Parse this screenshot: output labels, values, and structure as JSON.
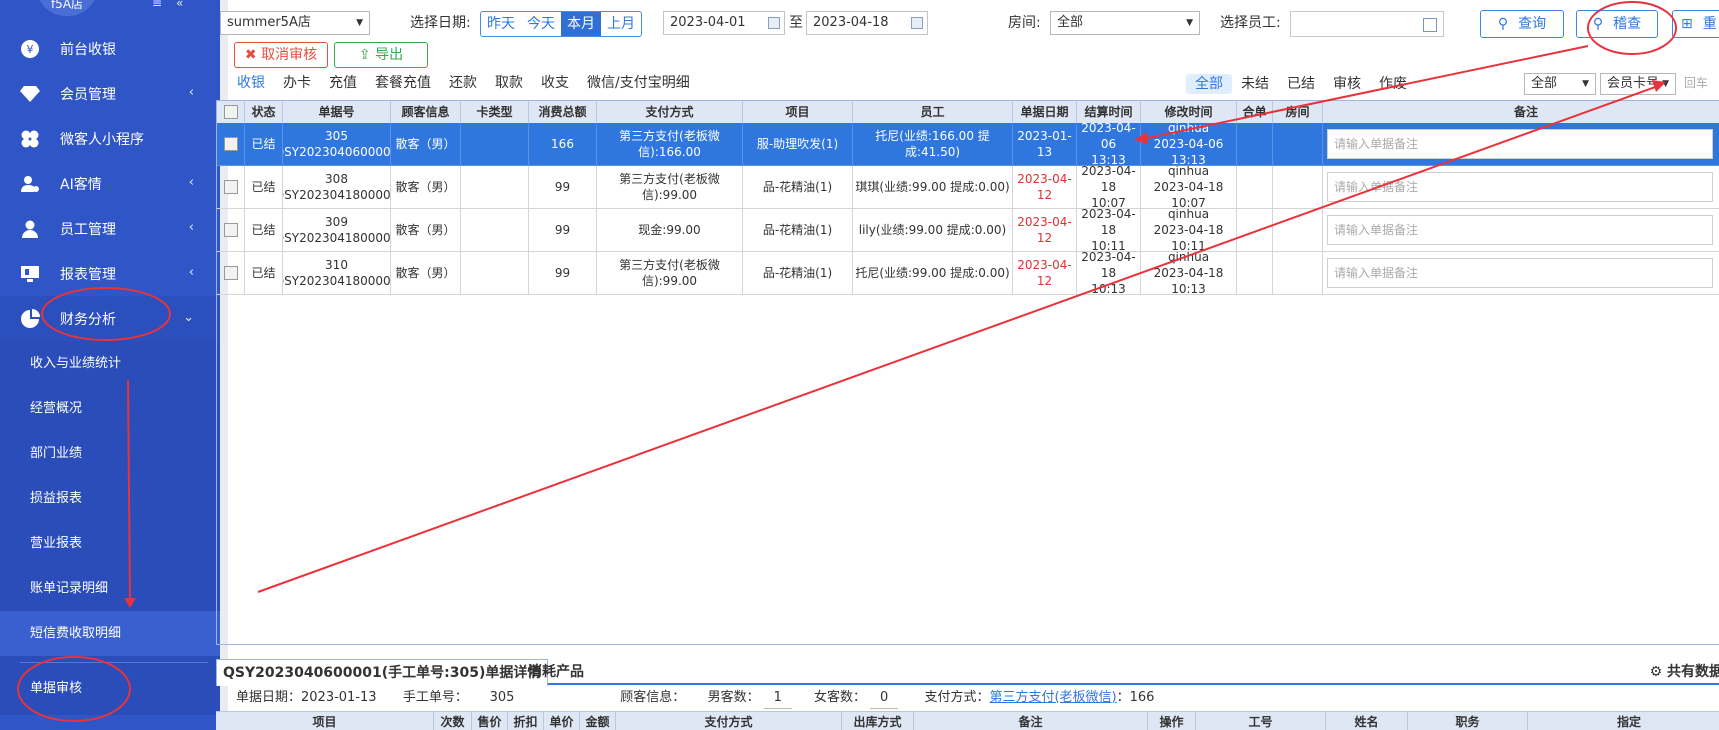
{
  "sidebar": {
    "logo": "f5A店",
    "menu": [
      {
        "label": "前台收银",
        "icon": "yen-icon",
        "arrow": ""
      },
      {
        "label": "会员管理",
        "icon": "diamond-icon",
        "arrow": "‹"
      },
      {
        "label": "微客人小程序",
        "icon": "clover-icon",
        "arrow": ""
      },
      {
        "label": "AI客情",
        "icon": "user-chat-icon",
        "arrow": "‹"
      },
      {
        "label": "员工管理",
        "icon": "person-icon",
        "arrow": "‹"
      },
      {
        "label": "报表管理",
        "icon": "monitor-icon",
        "arrow": "‹"
      },
      {
        "label": "财务分析",
        "icon": "pie-chart-icon",
        "arrow": "⌄"
      }
    ],
    "sub": [
      "收入与业绩统计",
      "经营概况",
      "部门业绩",
      "损益报表",
      "营业报表",
      "账单记录明细",
      "短信费收取明细"
    ],
    "last": "单据审核"
  },
  "toolbar": {
    "store": "summer5A店",
    "date_label": "选择日期:",
    "quick": [
      "昨天",
      "今天",
      "本月",
      "上月"
    ],
    "date_from": "2023-04-01",
    "to": "至",
    "date_to": "2023-04-18",
    "room_label": "房间:",
    "room_value": "全部",
    "emp_label": "选择员工:",
    "query": "查询",
    "audit": "稽查",
    "reset": "重"
  },
  "actions": {
    "cancel_audit": "取消审核",
    "export": "导出"
  },
  "tabs": [
    "收银",
    "办卡",
    "充值",
    "套餐充值",
    "还款",
    "取款",
    "收支",
    "微信/支付宝明细"
  ],
  "filters": [
    "全部",
    "未结",
    "已结",
    "审核",
    "作废"
  ],
  "filter_select": "全部",
  "card_select": "会员卡号",
  "enter_hint": "回车",
  "table": {
    "headers": [
      "",
      "状态",
      "单据号",
      "顾客信息",
      "卡类型",
      "消费总额",
      "支付方式",
      "项目",
      "员工",
      "单据日期",
      "结算时间",
      "修改时间",
      "合单",
      "房间",
      "备注"
    ],
    "note_placeholder": "请输入单据备注",
    "rows": [
      {
        "status": "已结",
        "no1": "305",
        "no2": "QSY2023040600001",
        "customer": "散客（男）",
        "card": "",
        "total": "166",
        "pay": "第三方支付(老板微信):166.00",
        "item": "服-助理吹发(1)",
        "staff": "托尼(业绩:166.00 提成:41.50)",
        "date": "2023-01-13",
        "settle1": "2023-04-06",
        "settle2": "13:13",
        "mod1": "qinhua",
        "mod2": "2023-04-06 13:13",
        "merge": "",
        "room": ""
      },
      {
        "status": "已结",
        "no1": "308",
        "no2": "QSY2023041800001",
        "customer": "散客（男）",
        "card": "",
        "total": "99",
        "pay": "第三方支付(老板微信):99.00",
        "item": "品-花精油(1)",
        "staff": "琪琪(业绩:99.00 提成:0.00)",
        "date": "2023-04-12",
        "settle1": "2023-04-18",
        "settle2": "10:07",
        "mod1": "qinhua",
        "mod2": "2023-04-18 10:07",
        "merge": "",
        "room": ""
      },
      {
        "status": "已结",
        "no1": "309",
        "no2": "QSY2023041800002",
        "customer": "散客（男）",
        "card": "",
        "total": "99",
        "pay": "现金:99.00",
        "item": "品-花精油(1)",
        "staff": "lily(业绩:99.00 提成:0.00)",
        "date": "2023-04-12",
        "settle1": "2023-04-18",
        "settle2": "10:11",
        "mod1": "qinhua",
        "mod2": "2023-04-18 10:11",
        "merge": "",
        "room": ""
      },
      {
        "status": "已结",
        "no1": "310",
        "no2": "QSY2023041800003",
        "customer": "散客（男）",
        "card": "",
        "total": "99",
        "pay": "第三方支付(老板微信):99.00",
        "item": "品-花精油(1)",
        "staff": "托尼(业绩:99.00 提成:0.00)",
        "date": "2023-04-12",
        "settle1": "2023-04-18",
        "settle2": "10:13",
        "mod1": "qinhua",
        "mod2": "2023-04-18 10:13",
        "merge": "",
        "room": ""
      }
    ]
  },
  "detail": {
    "tab_active": "QSY2023040600001(手工单号:305)单据详情",
    "tab2": "消耗产品",
    "right_label": "共有数据",
    "date_label": "单据日期：",
    "date_value": "2023-01-13",
    "manual_label": "手工单号：",
    "manual_value": "305",
    "customer_label": "顾客信息：",
    "male_label": "男客数：",
    "male_value": "1",
    "female_label": "女客数：",
    "female_value": "0",
    "pay_label": "支付方式：",
    "pay_link": "第三方支付(老板微信)",
    "pay_amount": "：166",
    "headers": [
      "项目",
      "次数",
      "售价",
      "折扣",
      "单价",
      "金额",
      "支付方式",
      "出库方式",
      "备注",
      "操作",
      "工号",
      "姓名",
      "职务",
      "指定"
    ]
  },
  "colors": {
    "sidebar": "#2f55c6",
    "accent": "#2f76de",
    "danger": "#e84e40",
    "success": "#3aa94a",
    "annotation": "#e8333a"
  }
}
